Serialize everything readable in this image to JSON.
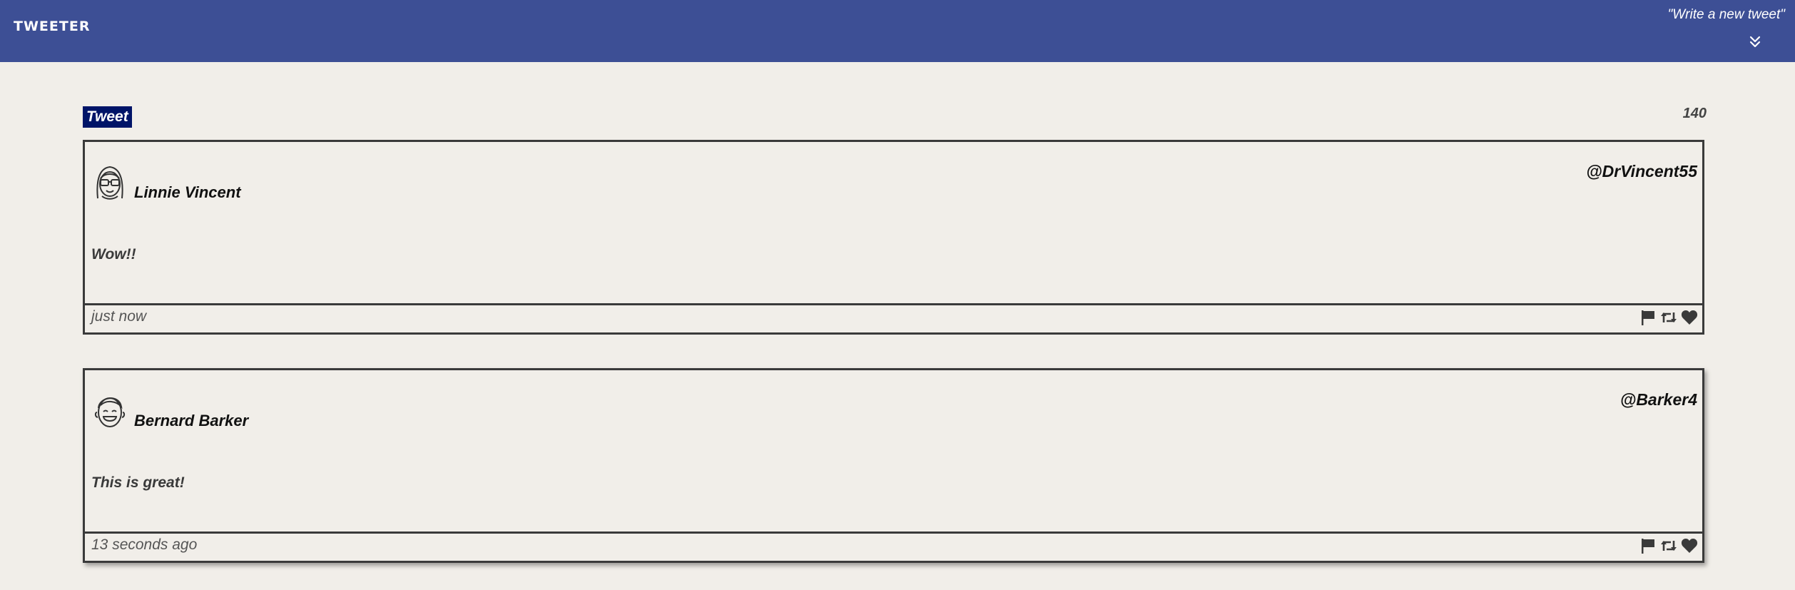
{
  "navbar": {
    "brand": "TWEETER",
    "compose_label": "\"Write a new tweet\"",
    "toggle_icon": "double-chevron-down-icon"
  },
  "composer": {
    "tweet_label": "Tweet",
    "char_count": "140"
  },
  "tweets": [
    {
      "name": "Linnie Vincent",
      "handle": "@DrVincent55",
      "content": "Wow!!",
      "time": "just now",
      "avatar": "avatar-glasses-icon"
    },
    {
      "name": "Bernard Barker",
      "handle": "@Barker4",
      "content": "This is great!",
      "time": "13 seconds ago",
      "avatar": "avatar-smile-icon"
    }
  ],
  "actions": [
    "flag-icon",
    "retweet-icon",
    "heart-icon"
  ],
  "colors": {
    "navbar": "#3d4f95",
    "background": "#f1eee9",
    "tweet_label_bg": "#001468",
    "border": "#3a3a3a"
  }
}
